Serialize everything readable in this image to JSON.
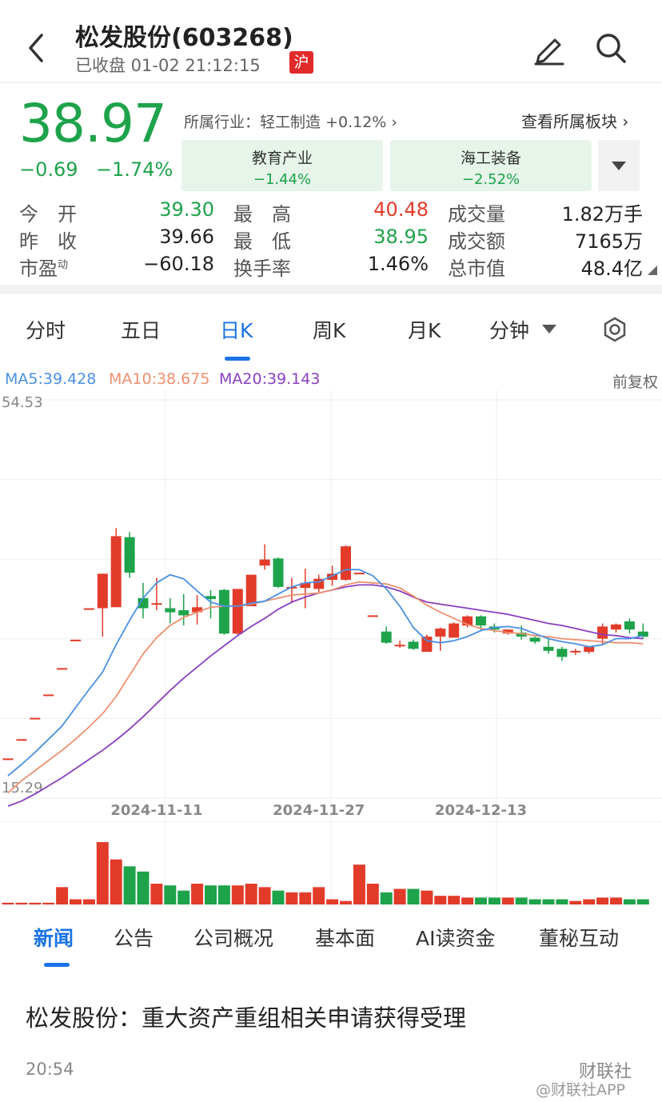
{
  "header": {
    "title": "松发股份(603268)",
    "status": "已收盘 01-02 21:12:15",
    "exchange_badge": "沪",
    "icons": [
      "back-icon",
      "edit-icon",
      "search-icon"
    ]
  },
  "quote": {
    "price": "38.97",
    "change": "−0.69",
    "change_pct": "−1.74%",
    "industry": "所属行业：轻工制造",
    "industry_change": "+0.12%",
    "view_sector": "查看所属板块",
    "sectors": [
      {
        "name": "教育产业",
        "change": "−1.44%"
      },
      {
        "name": "海工装备",
        "change": "−2.52%"
      }
    ]
  },
  "stats": {
    "rows": [
      [
        {
          "label": "今　开",
          "value": "39.30"
        },
        {
          "label": "最　高",
          "value": "40.48"
        },
        {
          "label": "成交量",
          "value": "1.82万手"
        }
      ],
      [
        {
          "label": "昨　收",
          "value": "39.66"
        },
        {
          "label": "最　低",
          "value": "38.95"
        },
        {
          "label": "成交额",
          "value": "7165万"
        }
      ],
      [
        {
          "label": "市盈",
          "sup": "动",
          "value": "−60.18"
        },
        {
          "label": "换手率",
          "value": "1.46%"
        },
        {
          "label": "总市值",
          "value": "48.4亿"
        }
      ]
    ]
  },
  "chart_tabs": [
    "分时",
    "五日",
    "日K",
    "周K",
    "月K",
    "分钟"
  ],
  "chart_tab_active": "日K",
  "ma": {
    "ma5": "MA5:39.428",
    "ma10": "MA10:38.675",
    "ma20": "MA20:39.143",
    "adjust": "前复权"
  },
  "colors": {
    "up": "#e33b2a",
    "down": "#1ea34b",
    "ma5": "#4a90e2",
    "ma10": "#ef8f6f",
    "ma20": "#8a3fc0",
    "accent": "#1a73e8"
  },
  "chart_data": {
    "type": "candlestick",
    "ylim": [
      15.29,
      54.53
    ],
    "y_top_label": "54.53",
    "y_bottom_label": "15.29",
    "date_labels": [
      {
        "label": "2024-11-11",
        "index": 11
      },
      {
        "label": "2024-11-27",
        "index": 23
      },
      {
        "label": "2024-12-13",
        "index": 35
      }
    ],
    "candles": [
      [
        19.2,
        19.2,
        19.2,
        19.2
      ],
      [
        21.1,
        21.1,
        21.1,
        21.1
      ],
      [
        23.2,
        23.2,
        23.2,
        23.2
      ],
      [
        25.5,
        25.5,
        25.5,
        25.5
      ],
      [
        28.1,
        28.1,
        28.1,
        28.1
      ],
      [
        30.9,
        30.9,
        30.9,
        30.9
      ],
      [
        34.0,
        34.0,
        34.0,
        34.0
      ],
      [
        34.0,
        37.4,
        36.0,
        31.2
      ],
      [
        34.1,
        41.1,
        41.9,
        34.1
      ],
      [
        41.0,
        37.5,
        41.5,
        37.0
      ],
      [
        35.0,
        34.0,
        36.5,
        33.0
      ],
      [
        34.5,
        34.5,
        37.0,
        33.8
      ],
      [
        34.0,
        33.6,
        35.0,
        32.5
      ],
      [
        33.8,
        33.3,
        35.4,
        32.3
      ],
      [
        33.6,
        34.1,
        35.3,
        32.4
      ],
      [
        35.2,
        34.9,
        35.8,
        33.0
      ],
      [
        35.8,
        31.5,
        35.9,
        31.4
      ],
      [
        31.5,
        35.9,
        35.9,
        31.4
      ],
      [
        34.2,
        37.3,
        37.3,
        34.2
      ],
      [
        38.2,
        38.8,
        40.3,
        37.8
      ],
      [
        38.9,
        36.1,
        39.0,
        36.0
      ],
      [
        36.0,
        36.1,
        37.0,
        34.5
      ],
      [
        36.0,
        36.5,
        37.9,
        34.0
      ],
      [
        35.9,
        36.9,
        37.3,
        35.6
      ],
      [
        36.8,
        37.4,
        38.2,
        36.2
      ],
      [
        36.8,
        40.1,
        40.2,
        36.7
      ],
      [
        37.5,
        37.5,
        37.5,
        37.5
      ],
      [
        33.3,
        33.3,
        33.3,
        33.3
      ],
      [
        31.7,
        30.6,
        32.2,
        30.5
      ],
      [
        30.4,
        30.4,
        30.8,
        30.1
      ],
      [
        30.7,
        30.0,
        30.9,
        29.9
      ],
      [
        29.7,
        31.2,
        31.4,
        29.7
      ],
      [
        31.2,
        32.0,
        32.1,
        29.8
      ],
      [
        31.1,
        32.5,
        32.6,
        31.1
      ],
      [
        32.3,
        33.2,
        33.3,
        32.1
      ],
      [
        33.2,
        32.3,
        33.3,
        31.8
      ],
      [
        32.2,
        31.9,
        32.5,
        31.6
      ],
      [
        31.5,
        31.9,
        31.9,
        31.4
      ],
      [
        31.6,
        31.2,
        32.3,
        30.9
      ],
      [
        31.1,
        30.7,
        31.2,
        30.5
      ],
      [
        30.2,
        29.8,
        31.1,
        29.5
      ],
      [
        30.0,
        29.2,
        30.2,
        28.8
      ],
      [
        29.7,
        29.8,
        30.0,
        29.4
      ],
      [
        29.7,
        30.2,
        30.2,
        29.5
      ],
      [
        31.0,
        32.2,
        32.5,
        30.4
      ],
      [
        31.9,
        32.4,
        32.5,
        31.6
      ],
      [
        32.7,
        31.9,
        33.0,
        31.5
      ],
      [
        31.7,
        31.2,
        32.5,
        31.0
      ]
    ],
    "ma5": [
      17.5,
      18.6,
      19.8,
      21.1,
      22.4,
      24.2,
      26.0,
      27.7,
      30.4,
      32.8,
      35.0,
      36.5,
      37.3,
      36.9,
      35.7,
      34.6,
      34.2,
      34.2,
      34.5,
      34.7,
      35.4,
      36.1,
      36.5,
      36.6,
      37.2,
      37.8,
      37.8,
      37.2,
      35.9,
      34.2,
      32.1,
      30.8,
      30.6,
      30.8,
      31.2,
      31.8,
      32.1,
      32.2,
      32.0,
      31.5,
      31.0,
      30.7,
      30.5,
      30.2,
      30.4,
      31.0,
      31.0,
      31.3
    ],
    "ma10": [
      15.8,
      17.0,
      18.0,
      19.0,
      20.0,
      21.1,
      22.3,
      23.6,
      25.3,
      27.4,
      29.5,
      31.1,
      32.3,
      33.1,
      33.6,
      34.1,
      34.2,
      34.2,
      34.4,
      34.7,
      35.0,
      35.3,
      35.4,
      35.5,
      35.8,
      36.3,
      36.6,
      36.5,
      36.4,
      36.0,
      35.2,
      34.3,
      33.6,
      33.0,
      32.4,
      32.0,
      31.8,
      31.6,
      31.5,
      31.3,
      31.2,
      31.0,
      30.9,
      30.8,
      30.7,
      30.6,
      30.6,
      30.5
    ],
    "ma20": [
      14.5,
      15.0,
      15.7,
      16.5,
      17.3,
      18.2,
      19.1,
      20.0,
      21.0,
      22.1,
      23.3,
      24.6,
      25.9,
      27.1,
      28.2,
      29.3,
      30.3,
      31.3,
      32.2,
      33.0,
      33.9,
      34.6,
      35.1,
      35.5,
      35.8,
      36.1,
      36.3,
      36.3,
      36.1,
      35.7,
      35.1,
      34.6,
      34.4,
      34.2,
      34.0,
      33.8,
      33.6,
      33.4,
      33.1,
      32.8,
      32.5,
      32.3,
      32.0,
      31.7,
      31.4,
      31.3,
      31.1,
      31.0
    ],
    "volumes": [
      1,
      1,
      1,
      1,
      10,
      3,
      3,
      36,
      26,
      22,
      19,
      12,
      11,
      8,
      12,
      11,
      11,
      11,
      12,
      10,
      8,
      7,
      7,
      10,
      3,
      2,
      23,
      12,
      7,
      9,
      9,
      8,
      5,
      5,
      4,
      4,
      4,
      4,
      4,
      3,
      3,
      3,
      2,
      3,
      4,
      4,
      3,
      3
    ]
  },
  "news_tabs": [
    "新闻",
    "公告",
    "公司概况",
    "基本面",
    "AI读资金",
    "董秘互动"
  ],
  "news_tab_active": "新闻",
  "news": {
    "headline": "松发股份：重大资产重组相关申请获得受理",
    "time": "20:54",
    "source": "财联社"
  },
  "watermark": "@财联社APP"
}
